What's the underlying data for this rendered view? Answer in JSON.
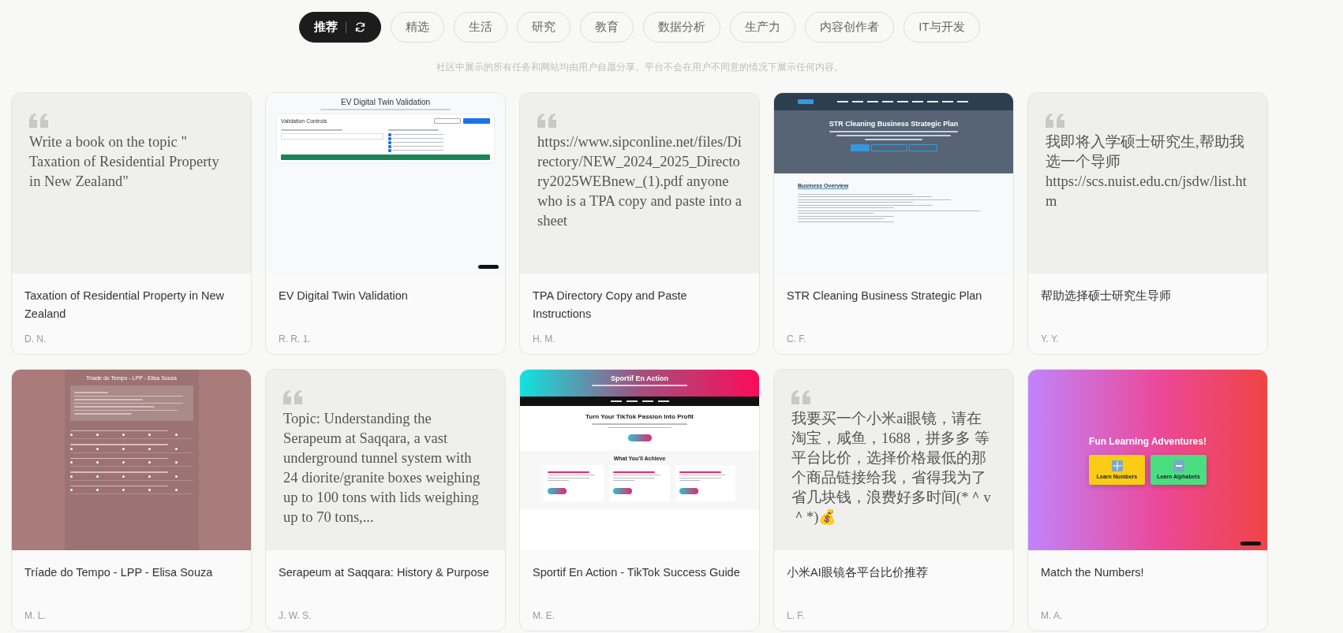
{
  "tabs": [
    {
      "label": "推荐",
      "selected": true
    },
    {
      "label": "精选",
      "selected": false
    },
    {
      "label": "生活",
      "selected": false
    },
    {
      "label": "研究",
      "selected": false
    },
    {
      "label": "教育",
      "selected": false
    },
    {
      "label": "数据分析",
      "selected": false
    },
    {
      "label": "生产力",
      "selected": false
    },
    {
      "label": "内容创作者",
      "selected": false
    },
    {
      "label": "IT与开发",
      "selected": false
    }
  ],
  "notice": "社区中展示的所有任务和网站均由用户自愿分享。平台不会在用户不同意的情况下展示任何内容。",
  "cards": [
    {
      "title": "Taxation of Residential Property in New Zealand",
      "author": "D. N.",
      "preview": {
        "kind": "quote",
        "text": "Write a book on the topic \" Taxation of Residential Property in New Zealand\""
      }
    },
    {
      "title": "EV Digital Twin Validation",
      "author": "R. R. 1.",
      "preview": {
        "kind": "validation",
        "title": "EV Digital Twin Validation",
        "panel_title": "Validation Controls",
        "approaches": [
          {
            "checked": true
          },
          {
            "checked": true
          },
          {
            "checked": true
          },
          {
            "checked": true
          },
          {
            "checked": true
          }
        ]
      }
    },
    {
      "title": "TPA Directory Copy and Paste Instructions",
      "author": "H. M.",
      "preview": {
        "kind": "quote",
        "text": "https://www.sipconline.net/files/Directory/NEW_2024_2025_Directory2025WEBnew_(1).pdf anyone who is a TPA copy and paste into a sheet"
      }
    },
    {
      "title": "STR Cleaning Business Strategic Plan",
      "author": "C. F.",
      "preview": {
        "kind": "strategy",
        "title": "STR Cleaning Business Strategic Plan",
        "section": "Business Overview"
      }
    },
    {
      "title": "帮助选择硕士研究生导师",
      "author": "Y. Y.",
      "preview": {
        "kind": "quote",
        "text": "我即将入学硕士研究生,帮助我选一个导师 https://scs.nuist.edu.cn/jsdw/list.htm"
      }
    },
    {
      "title": "Tríade do Tempo - LPP - Elisa Souza",
      "author": "M. L.",
      "preview": {
        "kind": "quiz",
        "title": "Tríade do Tempo - LPP - Elisa Souza"
      }
    },
    {
      "title": "Serapeum at Saqqara: History & Purpose",
      "author": "J. W. S.",
      "preview": {
        "kind": "quote",
        "text": "Topic: Understanding the Serapeum at Saqqara, a vast underground tunnel system with 24 diorite/granite boxes weighing up to 100 tons with lids weighing up to 70 tons,..."
      }
    },
    {
      "title": "Sportif En Action - TikTok Success Guide",
      "author": "M. E.",
      "preview": {
        "kind": "landing",
        "title": "Sportif En Action",
        "headline": "Turn Your TikTok Passion Into Profit",
        "section": "What You'll Achieve"
      }
    },
    {
      "title": "小米AI眼镜各平台比价推荐",
      "author": "L. F.",
      "preview": {
        "kind": "quote",
        "text": "我要买一个小米ai眼镜，请在淘宝，咸鱼，1688，拼多多 等平台比价，选择价格最低的那个商品链接给我，省得我为了省几块钱，浪费好多时间(*＾v＾*)💰"
      }
    },
    {
      "title": "Match the Numbers!",
      "author": "M. A.",
      "preview": {
        "kind": "game",
        "title": "Fun Learning Adventures!",
        "buttons": [
          {
            "label": "Learn Numbers",
            "kind": "numbers",
            "color": "#facc15"
          },
          {
            "label": "Learn Alphabets",
            "kind": "letters",
            "color": "#4ade80"
          }
        ]
      }
    }
  ]
}
